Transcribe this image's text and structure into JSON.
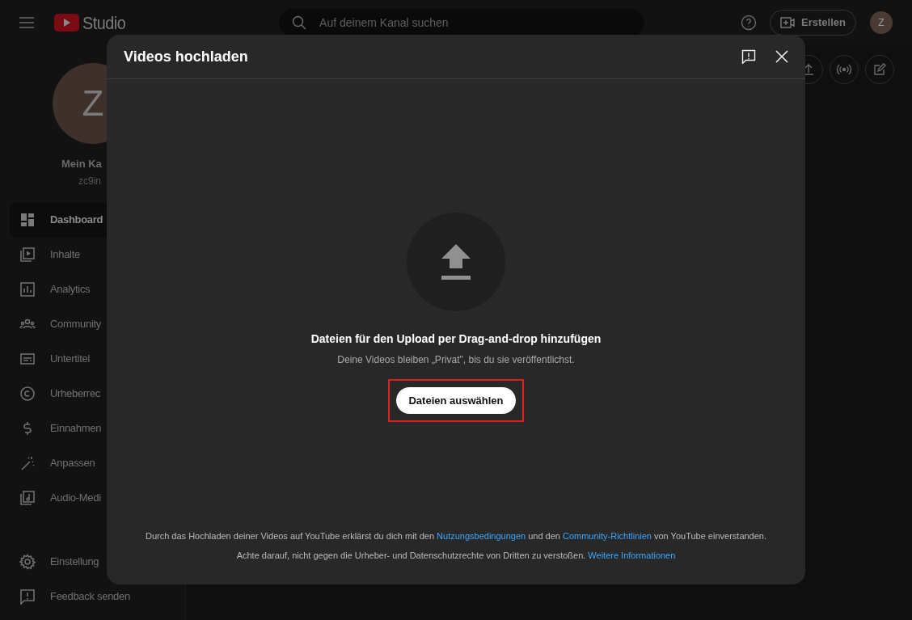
{
  "header": {
    "logo_text": "Studio",
    "search_placeholder": "Auf deinem Kanal suchen",
    "create_button": "Erstellen",
    "avatar_letter": "Z"
  },
  "channel": {
    "avatar_letter": "Z",
    "name": "Mein Ka",
    "handle": "zc9in"
  },
  "sidebar": {
    "items": [
      {
        "kind": "dashboard",
        "label": "Dashboard",
        "selected": true
      },
      {
        "kind": "content",
        "label": "Inhalte",
        "selected": false
      },
      {
        "kind": "analytics",
        "label": "Analytics",
        "selected": false
      },
      {
        "kind": "community",
        "label": "Community",
        "selected": false
      },
      {
        "kind": "subtitles",
        "label": "Untertitel",
        "selected": false
      },
      {
        "kind": "copyright",
        "label": "Urheberrec",
        "selected": false
      },
      {
        "kind": "money",
        "label": "Einnahmen",
        "selected": false
      },
      {
        "kind": "customize",
        "label": "Anpassen",
        "selected": false
      },
      {
        "kind": "audio",
        "label": "Audio-Medi",
        "selected": false
      }
    ],
    "bottom_items": [
      {
        "kind": "settings",
        "label": "Einstellung"
      },
      {
        "kind": "feedback",
        "label": "Feedback senden"
      }
    ]
  },
  "dialog": {
    "title": "Videos hochladen",
    "heading": "Dateien für den Upload per Drag-and-drop hinzufügen",
    "subtitle": "Deine Videos bleiben „Privat\", bis du sie veröffentlichst.",
    "select_button": "Dateien auswählen",
    "highlighted": true,
    "footer": [
      [
        {
          "kind": "text",
          "text": "Durch das Hochladen deiner Videos auf YouTube erklärst du dich mit den"
        },
        {
          "kind": "link",
          "text": "Nutzungsbedingungen"
        },
        {
          "kind": "text",
          "text": "und den"
        },
        {
          "kind": "link",
          "text": "Community-Richtlinien"
        },
        {
          "kind": "text",
          "text": "von YouTube einverstanden."
        }
      ],
      [
        {
          "kind": "text",
          "text": "Achte darauf, nicht gegen die Urheber- und Datenschutzrechte von Dritten zu verstoßen."
        },
        {
          "kind": "link",
          "text": "Weitere Informationen"
        }
      ]
    ]
  }
}
